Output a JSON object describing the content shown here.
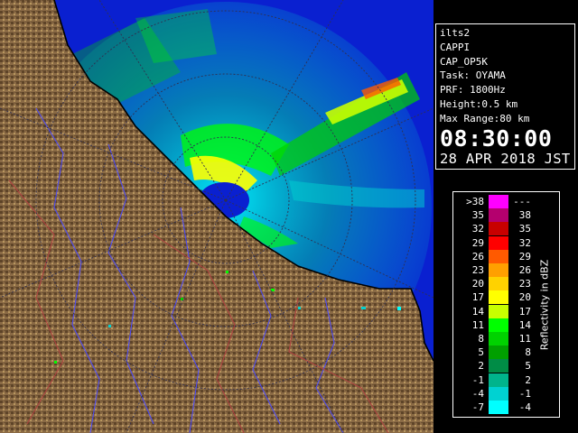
{
  "info": {
    "station": "ilts2",
    "product": "CAPPI",
    "product_code": "CAP_OP5K",
    "task": "Task: OYAMA",
    "prf": "PRF: 1800Hz",
    "height": "Height:0.5 km",
    "max_range": "Max Range:80 km",
    "time": "08:30:00",
    "date": "28 APR 2018 JST"
  },
  "legend": {
    "title": "Reflectivity in dBZ",
    "rows": [
      {
        "lo": ">38",
        "hi": "---",
        "color": "#ff00ff"
      },
      {
        "lo": "35",
        "hi": "38",
        "color": "#b4006e"
      },
      {
        "lo": "32",
        "hi": "35",
        "color": "#c80000"
      },
      {
        "lo": "29",
        "hi": "32",
        "color": "#ff0000"
      },
      {
        "lo": "26",
        "hi": "29",
        "color": "#ff5a00"
      },
      {
        "lo": "23",
        "hi": "26",
        "color": "#ffa000"
      },
      {
        "lo": "20",
        "hi": "23",
        "color": "#ffd200"
      },
      {
        "lo": "17",
        "hi": "20",
        "color": "#ffff00"
      },
      {
        "lo": "14",
        "hi": "17",
        "color": "#c8ff00"
      },
      {
        "lo": "11",
        "hi": "14",
        "color": "#00ff00"
      },
      {
        "lo": "8",
        "hi": "11",
        "color": "#00d200"
      },
      {
        "lo": "5",
        "hi": "8",
        "color": "#00a000"
      },
      {
        "lo": "2",
        "hi": "5",
        "color": "#008c46"
      },
      {
        "lo": "-1",
        "hi": "2",
        "color": "#00b48c"
      },
      {
        "lo": "-4",
        "hi": "-1",
        "color": "#00d2d2"
      },
      {
        "lo": "-7",
        "hi": "-4",
        "color": "#00ffff"
      }
    ]
  },
  "colors": {
    "sea": "#0a20d0",
    "land": "#8a6a45",
    "coast": "#000000",
    "river": "#4a4aff",
    "border": "#b04040"
  }
}
